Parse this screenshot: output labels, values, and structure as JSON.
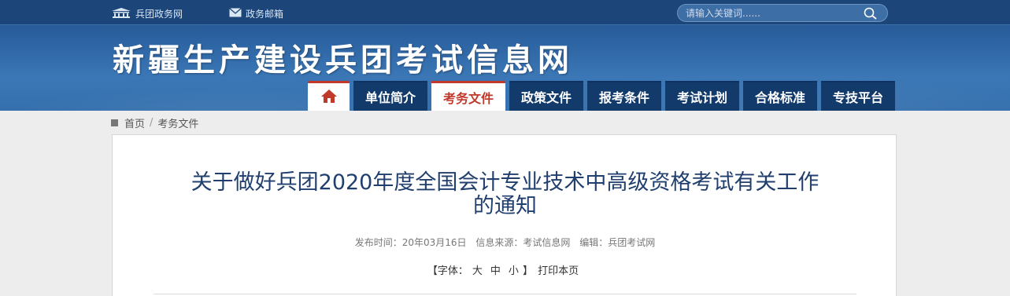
{
  "topbar": {
    "links": [
      {
        "label": "兵团政务网",
        "icon": "government-building-icon"
      },
      {
        "label": "政务邮箱",
        "icon": "mail-icon"
      }
    ],
    "search": {
      "placeholder": "请输入关键词......",
      "icon": "search-icon"
    }
  },
  "site": {
    "title": "新疆生产建设兵团考试信息网"
  },
  "nav": {
    "home_icon": "home-icon",
    "items": [
      {
        "label": "单位简介"
      },
      {
        "label": "考务文件"
      },
      {
        "label": "政策文件"
      },
      {
        "label": "报考条件"
      },
      {
        "label": "考试计划"
      },
      {
        "label": "合格标准"
      },
      {
        "label": "专技平台"
      }
    ],
    "active": "考务文件"
  },
  "breadcrumb": {
    "home": "首页",
    "separator": "/",
    "current": "考务文件"
  },
  "article": {
    "title_line1": "关于做好兵团2020年度全国会计专业技术中高级资格考试有关工作",
    "title_line2": "的通知",
    "publish_label": "发布时间：20年03月16日",
    "source_label": "信息来源：考试信息网",
    "editor_label": "编辑：兵团考试网",
    "font_prefix": "【字体：",
    "font_large": "大",
    "font_medium": "中",
    "font_small": "小",
    "font_suffix": "】",
    "print_label": "打印本页"
  },
  "colors": {
    "header_blue": "#2c62a1",
    "nav_dark": "#123a6b",
    "active_red": "#c0392b",
    "title_blue": "#203f6e"
  }
}
